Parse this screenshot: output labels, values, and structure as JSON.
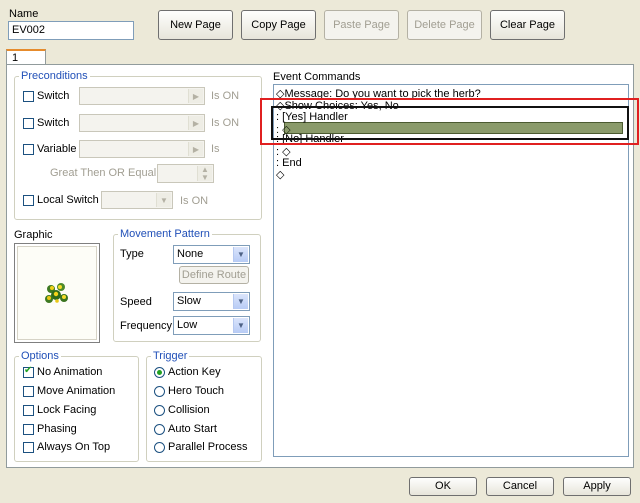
{
  "header": {
    "name_label": "Name",
    "name_value": "EV002",
    "buttons": {
      "new_page": "New Page",
      "copy_page": "Copy Page",
      "paste_page": "Paste Page",
      "delete_page": "Delete Page",
      "clear_page": "Clear Page"
    }
  },
  "tabs": [
    {
      "label": "1"
    }
  ],
  "preconditions": {
    "title": "Preconditions",
    "switch1_label": "Switch",
    "switch1_suffix": "Is ON",
    "switch2_label": "Switch",
    "switch2_suffix": "Is ON",
    "variable_label": "Variable",
    "variable_suffix": "Is",
    "compare_label": "Great Then OR Equal To",
    "local_switch_label": "Local Switch",
    "local_switch_suffix": "Is ON"
  },
  "graphic": {
    "title": "Graphic",
    "icon": "herb-sprite-icon"
  },
  "movement": {
    "title": "Movement Pattern",
    "type_label": "Type",
    "type_value": "None",
    "define_route": "Define Route",
    "speed_label": "Speed",
    "speed_value": "Slow",
    "frequency_label": "Frequency",
    "frequency_value": "Low"
  },
  "options": {
    "title": "Options",
    "items": [
      {
        "label": "No Animation",
        "checked": true
      },
      {
        "label": "Move Animation",
        "checked": false
      },
      {
        "label": "Lock Facing",
        "checked": false
      },
      {
        "label": "Phasing",
        "checked": false
      },
      {
        "label": "Always On Top",
        "checked": false
      }
    ]
  },
  "trigger": {
    "title": "Trigger",
    "items": [
      {
        "label": "Action Key",
        "checked": true
      },
      {
        "label": "Hero Touch",
        "checked": false
      },
      {
        "label": "Collision",
        "checked": false
      },
      {
        "label": "Auto Start",
        "checked": false
      },
      {
        "label": "Parallel Process",
        "checked": false
      }
    ]
  },
  "commands": {
    "title": "Event Commands",
    "lines": [
      "◇Message: Do you want to pick the herb?",
      "◇Show Choices: Yes, No",
      ":  [Yes] Handler",
      ":  ◇",
      ":  [No] Handler",
      ":  ◇",
      ":  End",
      "◇"
    ]
  },
  "footer": {
    "ok": "OK",
    "cancel": "Cancel",
    "apply": "Apply"
  },
  "colors": {
    "highlight_annotation": "#e02020",
    "selection_row": "#8a9a6a",
    "legend_blue": "#2150b8"
  }
}
